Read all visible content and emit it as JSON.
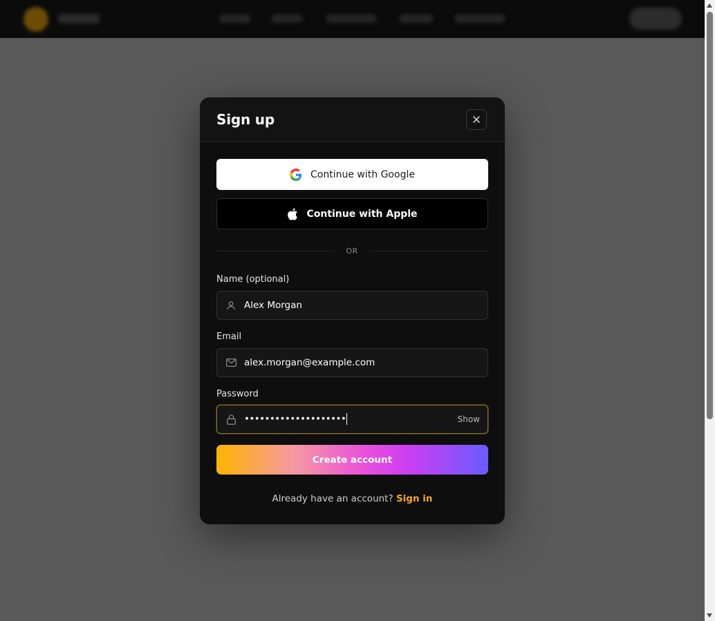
{
  "modal": {
    "title": "Sign up",
    "close_label": "×"
  },
  "oauth": {
    "google_label": "Continue with Google",
    "apple_label": "Continue with Apple"
  },
  "divider": {
    "text": "OR"
  },
  "form": {
    "name": {
      "label": "Name (optional)",
      "value": "Alex Morgan"
    },
    "email": {
      "label": "Email",
      "value": "alex.morgan@example.com"
    },
    "password": {
      "label": "Password",
      "masked_value": "••••••••••••••••••••",
      "show_label": "Show"
    },
    "submit_label": "Create account"
  },
  "footer": {
    "prompt": "Already have an account?",
    "signin_label": "Sign in"
  },
  "colors": {
    "accent": "#f5a623",
    "gradient_start": "#ffb300",
    "gradient_end": "#6a5cff",
    "modal_bg": "#0e0e0e",
    "backdrop": "#595959"
  }
}
